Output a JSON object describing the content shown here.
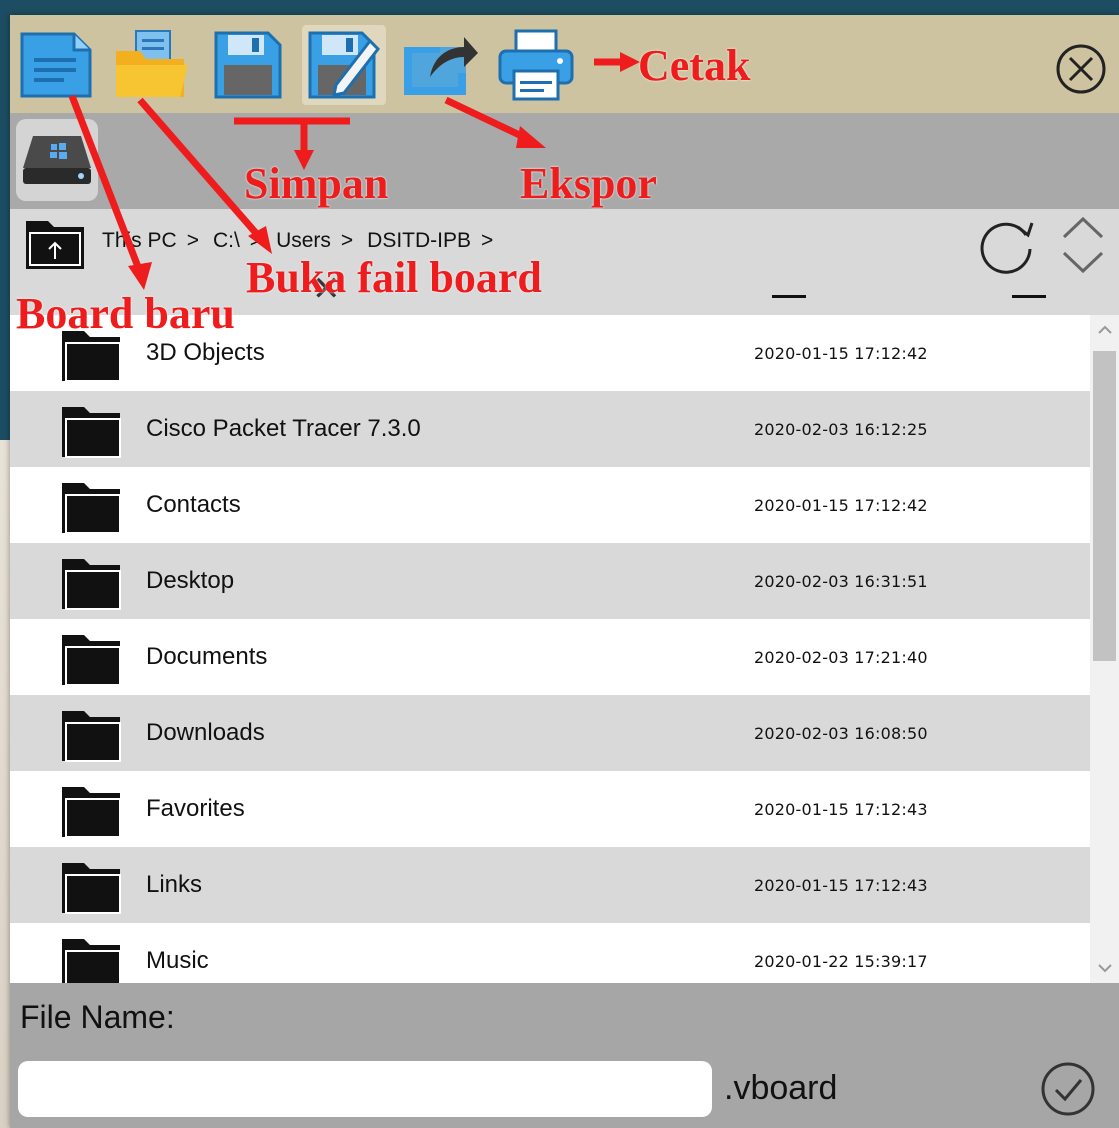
{
  "toolbar": {
    "buttons": [
      {
        "icon": "new-document-icon",
        "name": "new-board-button"
      },
      {
        "icon": "open-folder-icon",
        "name": "open-board-button"
      },
      {
        "icon": "save-icon",
        "name": "save-button"
      },
      {
        "icon": "save-as-icon",
        "name": "save-as-button"
      },
      {
        "icon": "export-icon",
        "name": "export-button"
      },
      {
        "icon": "print-icon",
        "name": "print-button"
      }
    ],
    "close_icon": "close-icon"
  },
  "drive": {
    "icon": "drive-icon"
  },
  "path": {
    "crumbs": [
      "This PC",
      "C:\\",
      "Users",
      "DSITD-IPB"
    ],
    "separator": ">"
  },
  "files": [
    {
      "name": "3D Objects",
      "date": "2020-01-15 17:12:42"
    },
    {
      "name": "Cisco Packet Tracer 7.3.0",
      "date": "2020-02-03 16:12:25"
    },
    {
      "name": "Contacts",
      "date": "2020-01-15 17:12:42"
    },
    {
      "name": "Desktop",
      "date": "2020-02-03 16:31:51"
    },
    {
      "name": "Documents",
      "date": "2020-02-03 17:21:40"
    },
    {
      "name": "Downloads",
      "date": "2020-02-03 16:08:50"
    },
    {
      "name": "Favorites",
      "date": "2020-01-15 17:12:43"
    },
    {
      "name": "Links",
      "date": "2020-01-15 17:12:43"
    },
    {
      "name": "Music",
      "date": "2020-01-22 15:39:17"
    }
  ],
  "footer": {
    "file_name_label": "File Name:",
    "file_name_value": "",
    "extension": ".vboard"
  },
  "annotations": {
    "print": "Cetak",
    "save": "Simpan",
    "export": "Ekspor",
    "open": "Buka fail board",
    "new": "Board baru"
  },
  "colors": {
    "annotation": "#ee1c1c",
    "toolbar_bg": "#cdc3a0",
    "row_alt": "#d9d9d9",
    "icon_blue": "#3aa0e6",
    "folder_yellow": "#f7c531"
  }
}
